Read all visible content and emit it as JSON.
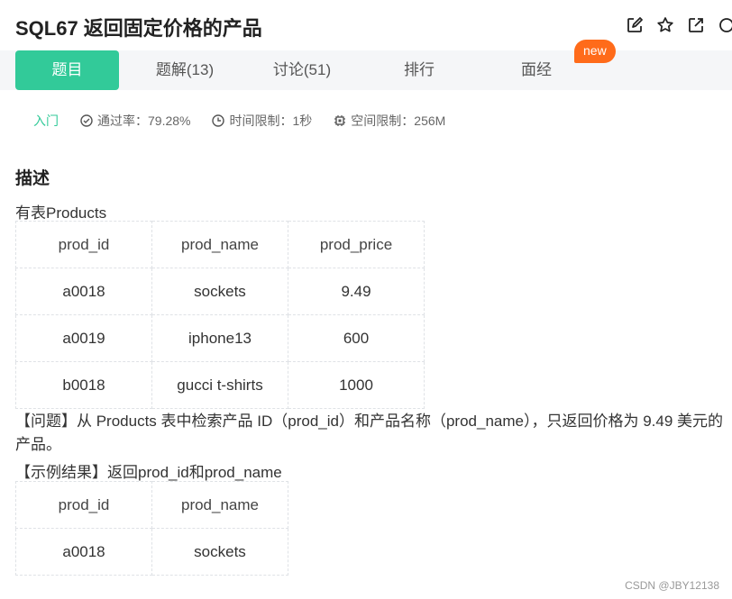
{
  "header": {
    "title": "SQL67  返回固定价格的产品"
  },
  "tabs": [
    {
      "label": "题目"
    },
    {
      "label": "题解(13)"
    },
    {
      "label": "讨论(51)"
    },
    {
      "label": "排行"
    },
    {
      "label": "面经"
    }
  ],
  "badge": "new",
  "meta": {
    "level": "入门",
    "pass_rate": "通过率：79.28%",
    "time_limit": "时间限制：1秒",
    "space_limit": "空间限制：256M"
  },
  "description": {
    "heading": "描述",
    "table_intro": "有表Products",
    "products_table": {
      "headers": [
        "prod_id",
        "prod_name",
        "prod_price"
      ],
      "rows": [
        [
          "a0018",
          "sockets",
          "9.49"
        ],
        [
          "a0019",
          "iphone13",
          "600"
        ],
        [
          "b0018",
          "gucci t-shirts",
          "1000"
        ]
      ]
    },
    "question": "【问题】从 Products 表中检索产品 ID（prod_id）和产品名称（prod_name），只返回价格为 9.49 美元的产品。",
    "example_intro": "【示例结果】返回prod_id和prod_name",
    "result_table": {
      "headers": [
        "prod_id",
        "prod_name"
      ],
      "rows": [
        [
          "a0018",
          "sockets"
        ]
      ]
    }
  },
  "watermark": "CSDN @JBY12138",
  "colors": {
    "accent": "#32ca99",
    "badge": "#ff6b1a",
    "tabbar_bg": "#f5f6f8"
  }
}
